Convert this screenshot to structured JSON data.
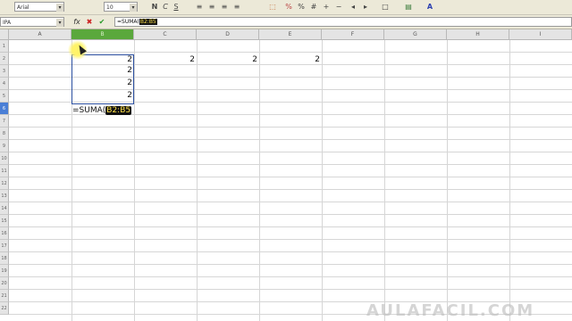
{
  "toolbar": {
    "font_name": "Arial",
    "font_size": "10",
    "bold": "N",
    "italic": "C",
    "underline": "S"
  },
  "formula_bar": {
    "name_box": "IPA",
    "function_wizard": "fx",
    "cancel": "✖",
    "accept": "✔",
    "input_prefix": "=SUMA(",
    "input_range": "B2:B5"
  },
  "columns": [
    "A",
    "B",
    "C",
    "D",
    "E",
    "F",
    "G",
    "H",
    "I"
  ],
  "rows": [
    "1",
    "2",
    "3",
    "4",
    "5",
    "6",
    "7",
    "8",
    "9",
    "10",
    "11",
    "12",
    "13",
    "14",
    "15",
    "16",
    "17",
    "18",
    "19",
    "20",
    "21",
    "22"
  ],
  "selected_column": "B",
  "selected_row": "6",
  "cells": {
    "B2": "2",
    "B3": "2",
    "B4": "2",
    "B5": "2",
    "C2": "2",
    "D2": "2",
    "E2": "2"
  },
  "active_cell_formula": {
    "prefix": "=SUMA(",
    "range": "B2:B5"
  },
  "watermark": "AULAFACIL.COM",
  "colors": {
    "selected_column_header": "#5aa83c",
    "selected_row_header": "#4a7fd6",
    "range_highlight": "#111111",
    "range_text": "#ffe24a"
  }
}
